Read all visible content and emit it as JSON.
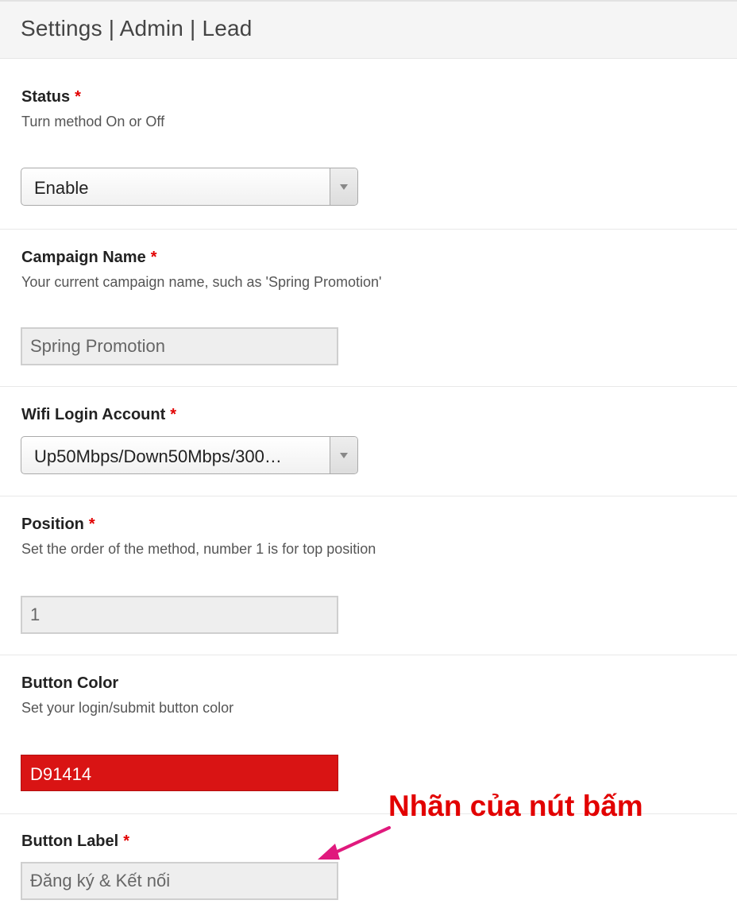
{
  "header": {
    "title": "Settings | Admin | Lead"
  },
  "fields": {
    "status": {
      "label": "Status",
      "required_mark": "*",
      "description": "Turn method On or Off",
      "value": "Enable"
    },
    "campaign_name": {
      "label": "Campaign Name",
      "required_mark": "*",
      "description": "Your current campaign name, such as 'Spring Promotion'",
      "value": "Spring Promotion"
    },
    "wifi_login_account": {
      "label": "Wifi Login Account",
      "required_mark": "*",
      "value": "Up50Mbps/Down50Mbps/300…"
    },
    "position": {
      "label": "Position",
      "required_mark": "*",
      "description": "Set the order of the method, number 1 is for top position",
      "value": "1"
    },
    "button_color": {
      "label": "Button Color",
      "description": "Set your login/submit button color",
      "value": "D91414",
      "color": "#D91414"
    },
    "button_label": {
      "label": "Button Label",
      "required_mark": "*",
      "value": "Đăng ký & Kết nối"
    }
  },
  "annotation": {
    "text": "Nhãn của nút bấm",
    "color": "#e20000",
    "arrow_color": "#e0197d"
  }
}
